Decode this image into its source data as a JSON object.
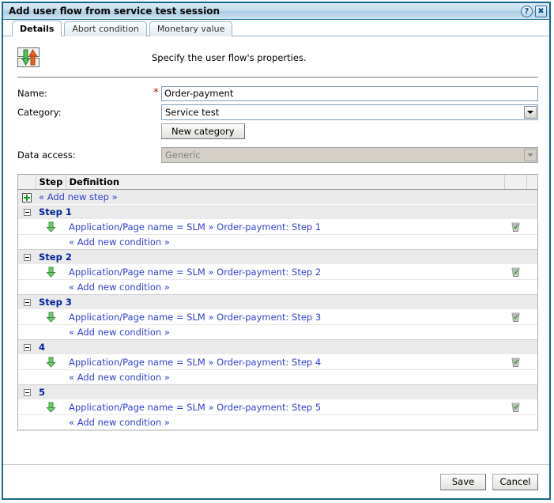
{
  "window": {
    "title": "Add user flow from service test session",
    "help_label": "?",
    "close_label": "✖"
  },
  "tabs": [
    {
      "label": "Details",
      "active": true
    },
    {
      "label": "Abort condition",
      "active": false
    },
    {
      "label": "Monetary value",
      "active": false
    }
  ],
  "header": {
    "description": "Specify the user flow's properties.",
    "icon": "user-flow-icon"
  },
  "form": {
    "name": {
      "label": "Name:",
      "required_marker": "*",
      "value": "Order-payment"
    },
    "category": {
      "label": "Category:",
      "value": "Service test"
    },
    "new_category_button": "New category",
    "data_access": {
      "label": "Data access:",
      "value": "Generic",
      "disabled": true
    }
  },
  "steps_table": {
    "columns": [
      "",
      "Step",
      "Definition",
      "",
      ""
    ],
    "add_new_step_label": "« Add new step »",
    "add_new_condition_label": "« Add new condition »",
    "groups": [
      {
        "name": "Step 1",
        "condition": "Application/Page name = SLM » Order-payment: Step 1"
      },
      {
        "name": "Step 2",
        "condition": "Application/Page name = SLM » Order-payment: Step 2"
      },
      {
        "name": "Step 3",
        "condition": "Application/Page name = SLM » Order-payment: Step 3"
      },
      {
        "name": "4",
        "condition": "Application/Page name = SLM » Order-payment: Step 4"
      },
      {
        "name": "5",
        "condition": "Application/Page name = SLM » Order-payment: Step 5"
      }
    ]
  },
  "footer": {
    "save_label": "Save",
    "cancel_label": "Cancel"
  },
  "colors": {
    "border": "#15688f",
    "link": "#2f3fd0",
    "group": "#00219b",
    "required": "#cc0000",
    "accent_green": "#0f9a0f",
    "accent_orange": "#e8621a"
  }
}
